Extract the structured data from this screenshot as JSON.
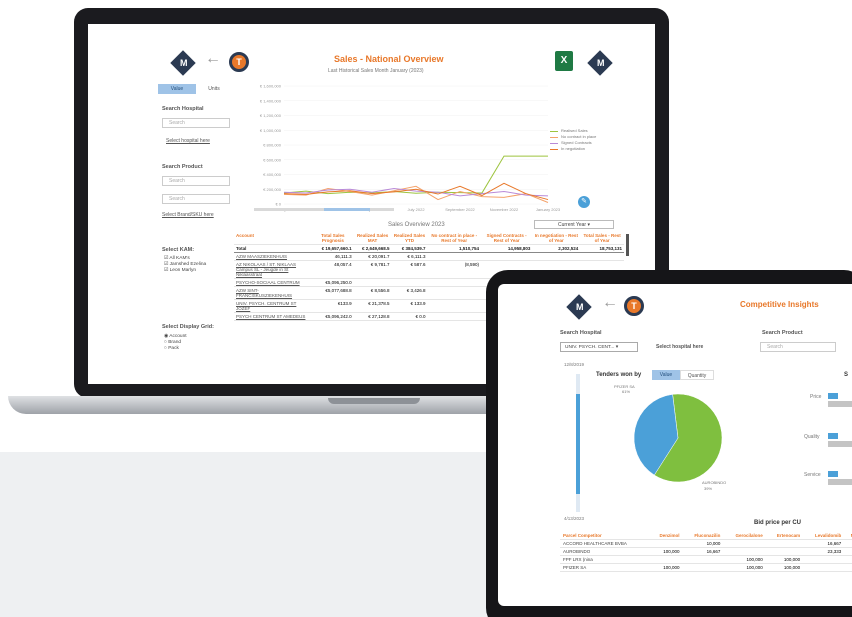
{
  "laptop": {
    "title": "Sales - National Overview",
    "subtitle": "Last Historical Sales Month January (2023)",
    "toggle": {
      "value_label": "Value",
      "units_label": "Units"
    },
    "search_hospital": {
      "label": "Search Hospital",
      "placeholder": "Search",
      "link": "Select hospital here"
    },
    "search_product": {
      "label": "Search Product",
      "placeholder": "Search",
      "placeholder2": "Search",
      "link": "Select Brand/SKU here"
    },
    "kam": {
      "label": "Select KAM:",
      "options": [
        "All KAM's",
        "Jamshed Ezelina",
        "Leon Marlyn"
      ]
    },
    "grid": {
      "label": "Select Display Grid:",
      "options": [
        "Account",
        "Brand",
        "Pack"
      ]
    },
    "chart_yticks": [
      "€ 1,600,000",
      "€ 1,400,000",
      "€ 1,200,000",
      "€ 1,000,000",
      "€ 800,000",
      "€ 600,000",
      "€ 400,000",
      "€ 200,000",
      "€ 0"
    ],
    "chart_xticks": [
      "January 2022",
      "March 2022",
      "May 2022",
      "July 2022",
      "September 2022",
      "November 2022",
      "January 2023"
    ],
    "chart_legend": [
      "Realised Sales",
      "No contract in place",
      "Signed Contracts",
      "In negotiation"
    ],
    "overview_title": "Sales Overview",
    "overview_year": "2023",
    "period_select": "Current Year",
    "columns": [
      "Account",
      "Total Sales Prognosis",
      "Realized Sales MAT",
      "Realized Sales YTD",
      "No contract in place - Rest of Year",
      "Signed Contracts - Rest of Year",
      "In negotiation - Rest of Year",
      "Total Sales - Rest of Year"
    ],
    "total_row": [
      "Total",
      "€ 19,657,660.1",
      "€ 2,649,668.5",
      "€ 384,539.7",
      "1,510,754",
      "14,958,803",
      "2,302,524",
      "18,753,131"
    ],
    "rows": [
      [
        "AZW MAASZIEKENHUIS",
        "46,111.3",
        "€ 20,091.7",
        "€ 6,111.3",
        "",
        "",
        "",
        ""
      ],
      [
        "AZ NIKOLAAS / ST. NIKLAAS Campus SL - Jeugde in St Niklaasstraat",
        "48,057.4",
        "€ 9,781.7",
        "€ 587.6",
        "(8,590)",
        "",
        "",
        ""
      ],
      [
        "PSYCHO-SOCIAAL CENTRUM",
        "€5,096,250.0",
        "",
        "",
        "",
        "",
        "",
        ""
      ],
      [
        "AZW SINT-FRANCISKUSZIEKENHUIS",
        "€5,077,688.8",
        "€ 8,556.8",
        "€ 3,426.8",
        "",
        "",
        "",
        ""
      ],
      [
        "UNIV. PSYCH. CENTRUM ST JOZEF",
        "€133.9",
        "€ 21,378.5",
        "€ 133.9",
        "",
        "",
        "",
        ""
      ],
      [
        "PSYCH CENTRUM ST AMEDEUS",
        "€5,096,242.0",
        "€ 27,128.8",
        "€ 0.0",
        "",
        "",
        "",
        ""
      ]
    ],
    "chart_data": {
      "type": "line",
      "x": [
        "January 2022",
        "February 2022",
        "March 2022",
        "April 2022",
        "May 2022",
        "June 2022",
        "July 2022",
        "August 2022",
        "September 2022",
        "October 2022",
        "November 2022",
        "December 2022",
        "January 2023"
      ],
      "ylim": [
        0,
        1600000
      ],
      "series": [
        {
          "name": "Realised Sales",
          "color": "#9dc43f",
          "values": [
            150000,
            175000,
            140000,
            160000,
            150000,
            170000,
            145000,
            160000,
            155000,
            150000,
            650000,
            650000,
            650000
          ]
        },
        {
          "name": "No contract in place",
          "color": "#f4a26b",
          "values": [
            130000,
            120000,
            210000,
            170000,
            120000,
            180000,
            240000,
            60000,
            170000,
            100000,
            90000,
            140000,
            20000
          ]
        },
        {
          "name": "Signed Contracts",
          "color": "#b98ad8",
          "values": [
            160000,
            150000,
            190000,
            200000,
            160000,
            210000,
            175000,
            160000,
            110000,
            140000,
            170000,
            120000,
            110000
          ]
        },
        {
          "name": "In negotiation",
          "color": "#e8782a",
          "values": [
            140000,
            130000,
            165000,
            180000,
            140000,
            165000,
            200000,
            135000,
            240000,
            115000,
            280000,
            140000,
            60000
          ]
        }
      ]
    }
  },
  "tablet": {
    "title": "Competitive Insights",
    "search_hospital": {
      "label": "Search Hospital",
      "value": "UNIV. PSYCH. CENT...",
      "link": "Select hospital here"
    },
    "search_product": {
      "label": "Search Product",
      "placeholder": "Search"
    },
    "date_top": "12/8/2019",
    "date_bottom": "4/13/2023",
    "tenders_title": "Tenders won by",
    "toggle": {
      "value_label": "Value",
      "quantity_label": "Quantity"
    },
    "pie_labels": {
      "pfizer": "PFIZER SA",
      "pfizer_pct": "61%",
      "aurobindo": "AUROBINDO",
      "aurobindo_pct": "39%"
    },
    "right_title": "S",
    "right_labels": [
      "Price",
      "Quality",
      "Service"
    ],
    "bid_title": "Bid price per CU",
    "bid_columns": [
      "Parcel Competitor",
      "Denzimol",
      "Fluconazilin",
      "Gerocilalone",
      "Ertenocam",
      "Levalidomib",
      "Ma"
    ],
    "bid_rows": [
      [
        "ACCORD HEALTHCARE BVBA",
        "",
        "10,000",
        "",
        "",
        "16,667",
        ""
      ],
      [
        "AUROBINDO",
        "100,000",
        "16,667",
        "",
        "",
        "23,333",
        ""
      ],
      [
        "FPF LRX (nina",
        "",
        "",
        "100,000",
        "100,000",
        "",
        ""
      ],
      [
        "PFIZER SA",
        "100,000",
        "",
        "100,000",
        "100,000",
        "",
        ""
      ]
    ],
    "chart_data": {
      "type": "pie",
      "slices": [
        {
          "label": "PFIZER SA",
          "value": 61,
          "color": "#7fbf3f"
        },
        {
          "label": "AUROBINDO",
          "value": 39,
          "color": "#4ba0d8"
        }
      ]
    }
  },
  "brand": {
    "logo_letter": "M",
    "t_letter": "T",
    "excel_letter": "X",
    "back_glyph": "←"
  }
}
